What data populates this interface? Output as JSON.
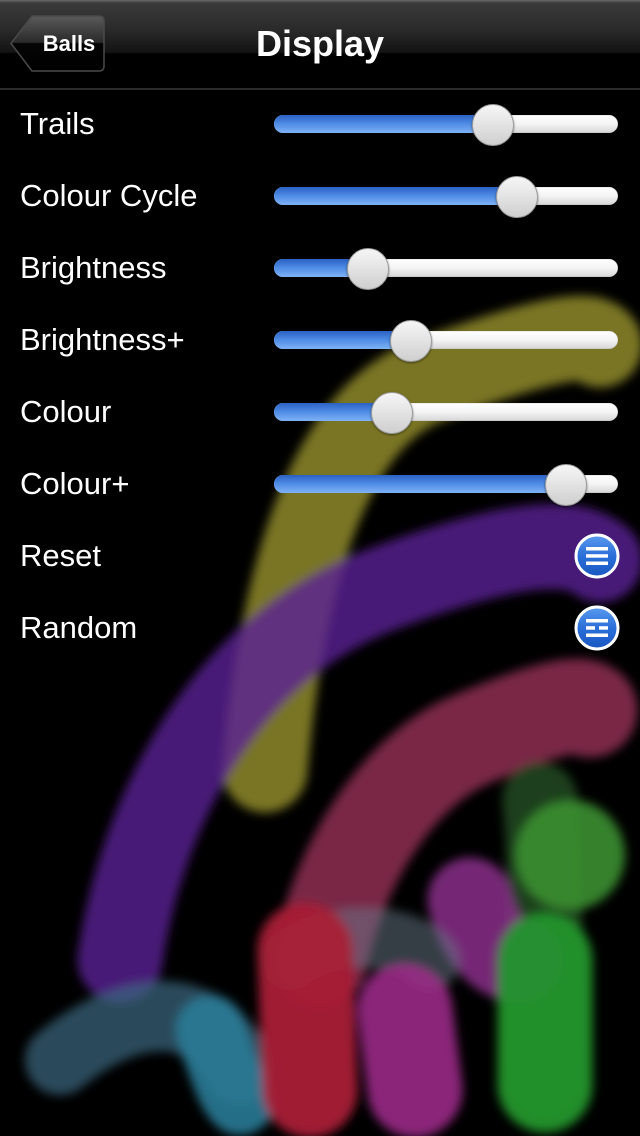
{
  "navbar": {
    "back_label": "Balls",
    "title": "Display"
  },
  "settings": [
    {
      "label": "Trails",
      "type": "slider",
      "value": 0.65
    },
    {
      "label": "Colour Cycle",
      "type": "slider",
      "value": 0.73
    },
    {
      "label": "Brightness",
      "type": "slider",
      "value": 0.24
    },
    {
      "label": "Brightness+",
      "type": "slider",
      "value": 0.38
    },
    {
      "label": "Colour",
      "type": "slider",
      "value": 0.32
    },
    {
      "label": "Colour+",
      "type": "slider",
      "value": 0.89
    },
    {
      "label": "Reset",
      "type": "button",
      "icon": "three-lines-icon"
    },
    {
      "label": "Random",
      "type": "button",
      "icon": "broken-lines-icon"
    }
  ],
  "colors": {
    "slider_fill": "#4b89e4",
    "button_blue": "#2a6fd8",
    "trail_yellow": "#a6a02a",
    "trail_purple": "#5e1fa6",
    "trail_pink": "#a0305a",
    "trail_green": "#2aa02e",
    "trail_cyan": "#2a8aa6",
    "trail_red": "#b01e3a",
    "trail_magenta": "#a02a8e"
  }
}
